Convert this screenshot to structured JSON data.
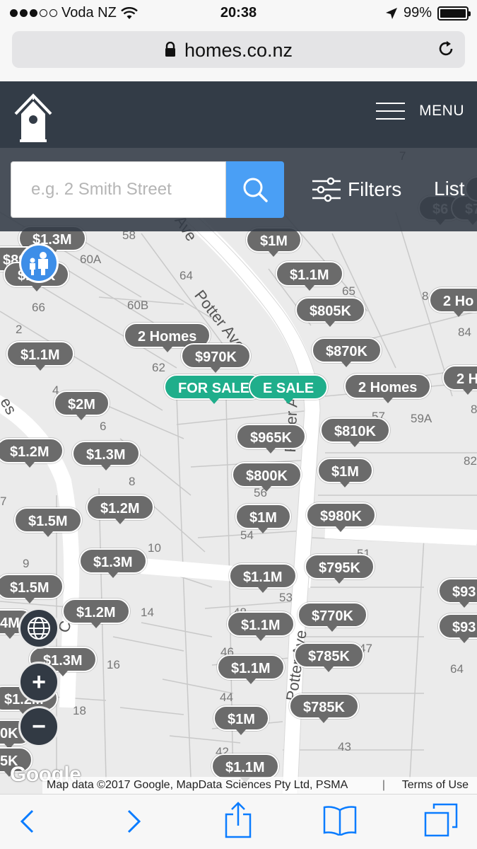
{
  "status_bar": {
    "carrier": "Voda NZ",
    "time": "20:38",
    "battery": "99%",
    "battery_level": 0.99,
    "signal_bars": 3
  },
  "browser": {
    "url": "homes.co.nz"
  },
  "site_header": {
    "menu_label": "MENU"
  },
  "search": {
    "placeholder": "e.g. 2 Smith Street",
    "filters_label": "Filters",
    "list_label": "List"
  },
  "map": {
    "streets": {
      "potter_ave_1": "Potter Ave",
      "potter_ave_2": "Potter Ave",
      "potter_ave_3": "Potter Ave",
      "potter_ave_top": "Ave",
      "left_street_1": "es",
      "left_street_2": "C"
    },
    "lot_numbers": [
      "58",
      "60A",
      "64",
      "60B",
      "66",
      "2",
      "62",
      "65",
      "84",
      "4",
      "6",
      "8",
      "59A",
      "82",
      "56",
      "54",
      "10",
      "9",
      "51",
      "53",
      "14",
      "48",
      "46",
      "47",
      "16",
      "44",
      "64",
      "18",
      "43",
      "42",
      "7",
      "57",
      "7",
      "8",
      "8"
    ],
    "pins": [
      "$1.3M",
      "$89",
      "$1.1K",
      "$1M",
      "$1.1M",
      "$805K",
      "2 Homes",
      "$970K",
      "$1.1M",
      "$870K",
      "2 Ho",
      "FOR SALE",
      "E SALE",
      "2 Homes",
      "2 H",
      "$2M",
      "$965K",
      "$810K",
      "$1.2M",
      "$1.3M",
      "$800K",
      "$1M",
      "$1.2M",
      "$1.5M",
      "$1M",
      "$980K",
      "$1.3M",
      "$1.1M",
      "$795K",
      "$1.5M",
      "$93",
      "$1.2M",
      "$770K",
      "$1.1M",
      "$93",
      "4M",
      "$1.3M",
      "$785K",
      "$1.1M",
      "$1.2M",
      "$785K",
      "$1M",
      "0K",
      "5K",
      "$1.1M",
      "$6",
      "$7",
      "$6"
    ],
    "attribution": "Map data ©2017 Google, MapData Sciences Pty Ltd, PSMA",
    "terms": "Terms of Use",
    "google_logo": "Google",
    "zoom_in": "+",
    "zoom_out": "−"
  },
  "colors": {
    "header_bg": "#333c47",
    "search_button": "#4a9ff5",
    "pin_gray": "#6b6b6b",
    "pin_sale": "#1fae8b",
    "ios_blue": "#0a7cff"
  },
  "icons": {
    "logo": "birdhouse-icon",
    "menu": "hamburger-icon",
    "search": "search-icon",
    "filters": "sliders-icon",
    "pegman": "street-view-icon",
    "layers": "globe-icon",
    "back": "chevron-left-icon",
    "forward": "chevron-right-icon",
    "share": "share-icon",
    "bookmarks": "book-icon",
    "tabs": "tabs-icon"
  }
}
